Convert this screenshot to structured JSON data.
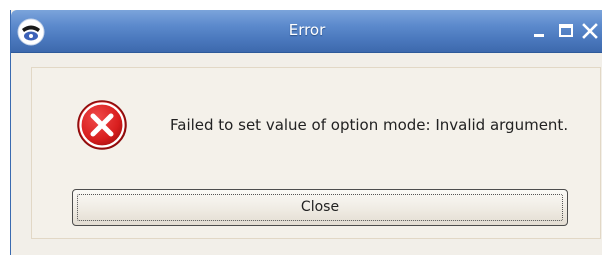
{
  "window": {
    "title": "Error",
    "app_icon": "telephone-app-icon",
    "controls": {
      "minimize_icon": "minimize-icon",
      "maximize_icon": "maximize-icon",
      "close_icon": "close-icon"
    }
  },
  "dialog": {
    "icon": "error-icon",
    "message": "Failed to set value of option mode: Invalid argument.",
    "button_label": "Close"
  },
  "colors": {
    "titlebar": "#4a78bd",
    "error_red": "#d81e1e",
    "background": "#f2efe9"
  }
}
